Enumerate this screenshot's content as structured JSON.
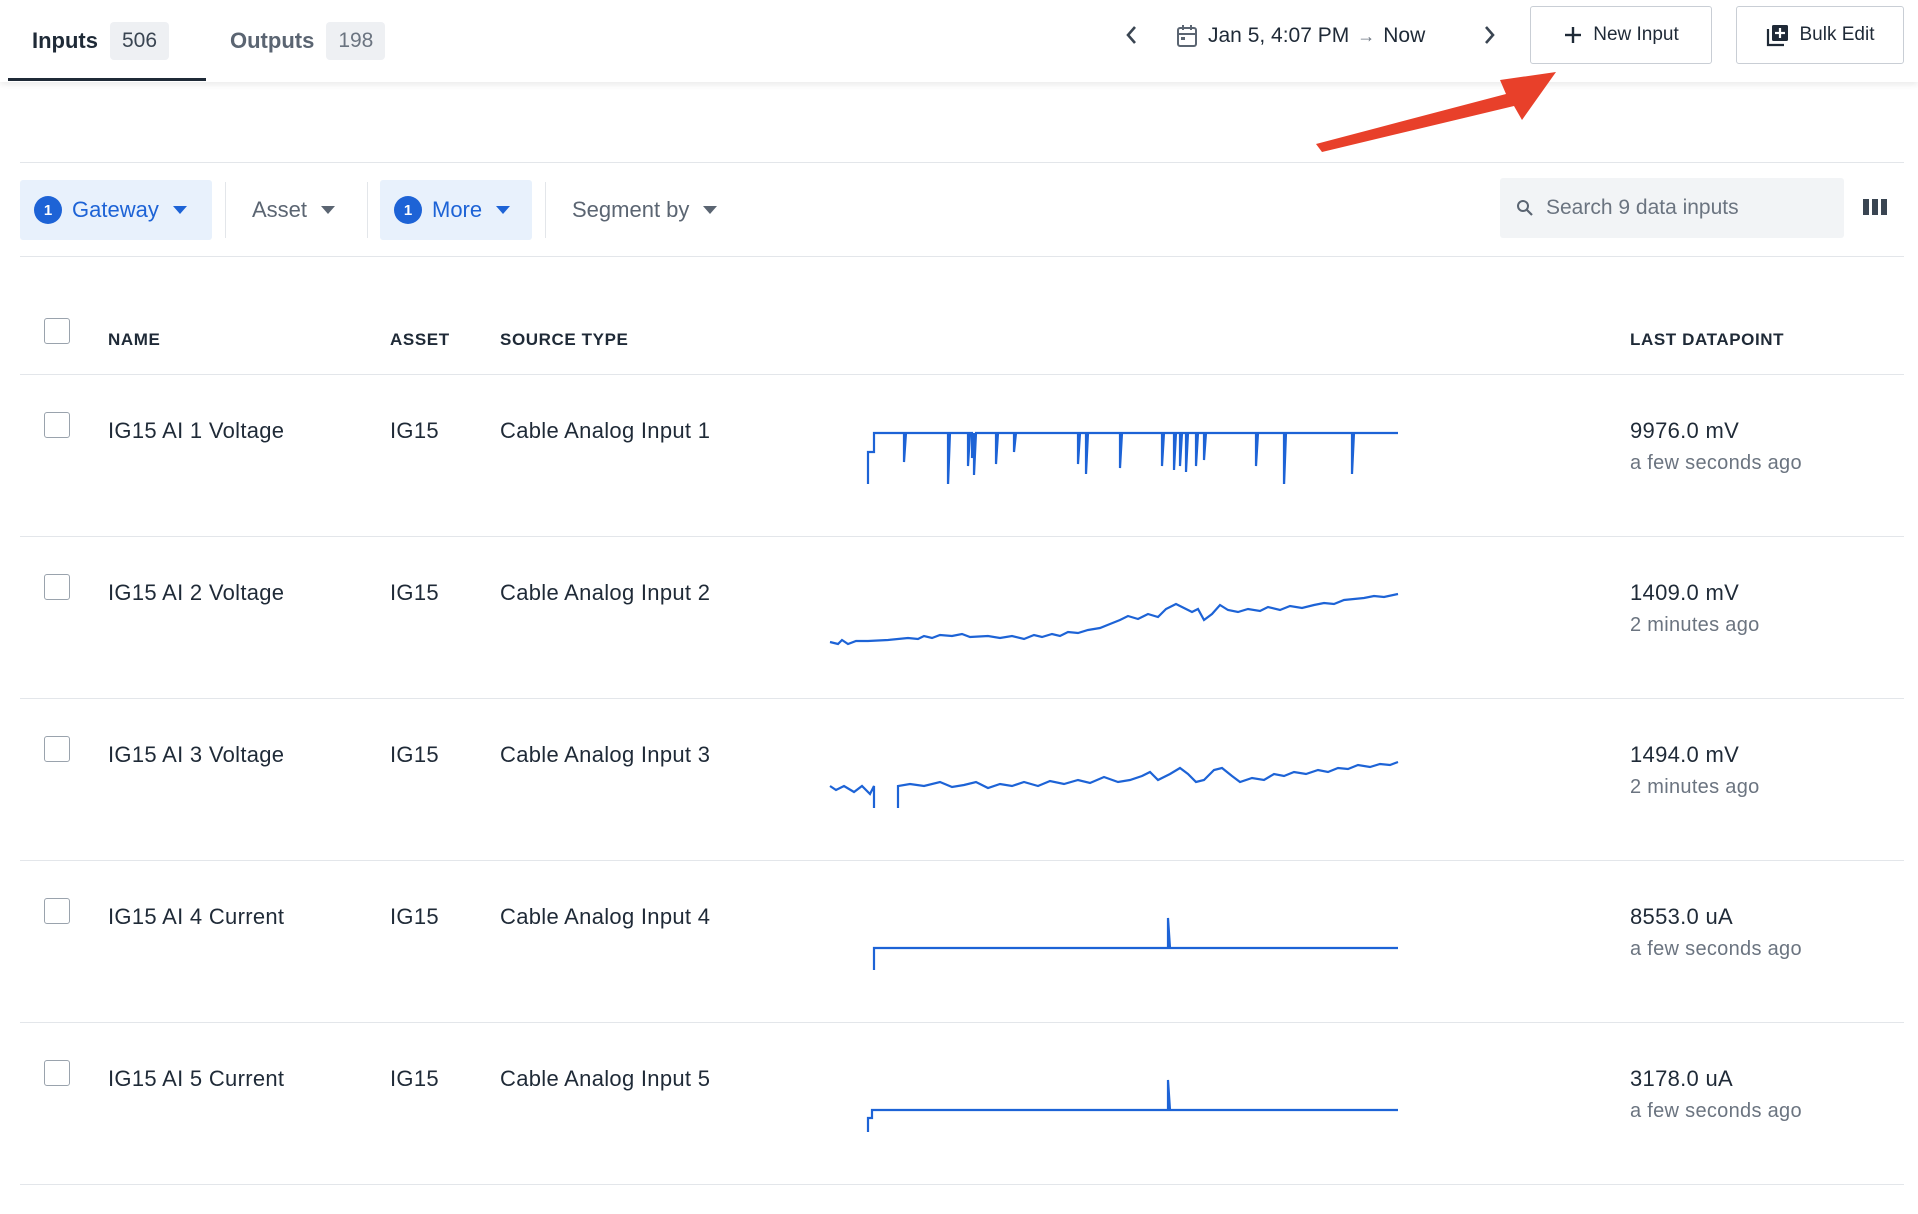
{
  "tabs": [
    {
      "label": "Inputs",
      "count": "506"
    },
    {
      "label": "Outputs",
      "count": "198"
    }
  ],
  "date_range": {
    "start": "Jan 5, 4:07 PM",
    "end": "Now"
  },
  "buttons": {
    "new_input": "New Input",
    "bulk_edit": "Bulk Edit"
  },
  "filters": [
    {
      "label": "Gateway",
      "badge": "1"
    },
    {
      "label": "Asset"
    },
    {
      "label": "More",
      "badge": "1"
    },
    {
      "label": "Segment by"
    }
  ],
  "search": {
    "placeholder": "Search 9 data inputs"
  },
  "table": {
    "headers": {
      "name": "NAME",
      "asset": "ASSET",
      "source_type": "SOURCE TYPE",
      "last_datapoint": "LAST DATAPOINT"
    },
    "rows": [
      {
        "name": "IG15 AI 1 Voltage",
        "asset": "IG15",
        "source_type": "Cable Analog Input 1",
        "last_value": "9976.0 mV",
        "last_time": "a few seconds ago"
      },
      {
        "name": "IG15 AI 2 Voltage",
        "asset": "IG15",
        "source_type": "Cable Analog Input 2",
        "last_value": "1409.0 mV",
        "last_time": "2 minutes ago"
      },
      {
        "name": "IG15 AI 3 Voltage",
        "asset": "IG15",
        "source_type": "Cable Analog Input 3",
        "last_value": "1494.0 mV",
        "last_time": "2 minutes ago"
      },
      {
        "name": "IG15 AI 4 Current",
        "asset": "IG15",
        "source_type": "Cable Analog Input 4",
        "last_value": "8553.0 uA",
        "last_time": "a few seconds ago"
      },
      {
        "name": "IG15 AI 5 Current",
        "asset": "IG15",
        "source_type": "Cable Analog Input 5",
        "last_value": "3178.0 uA",
        "last_time": "a few seconds ago"
      }
    ]
  },
  "colors": {
    "accent": "#1d63d6",
    "annotation_arrow": "#e8402a",
    "chip_bg": "#e8f1fc"
  }
}
